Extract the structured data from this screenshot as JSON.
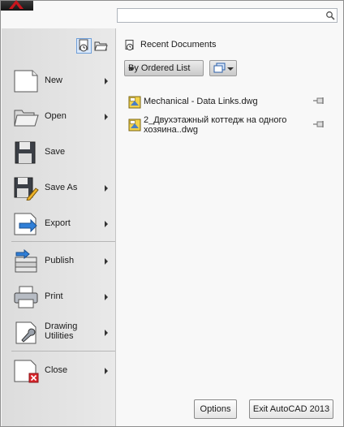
{
  "search": {
    "placeholder": ""
  },
  "menu": [
    {
      "label": "New",
      "icon": "new-document-icon",
      "submenu": true
    },
    {
      "label": "Open",
      "icon": "open-folder-icon",
      "submenu": true
    },
    {
      "label": "Save",
      "icon": "save-disk-icon",
      "submenu": false
    },
    {
      "label": "Save As",
      "icon": "save-as-icon",
      "submenu": true
    },
    {
      "label": "Export",
      "icon": "export-icon",
      "submenu": true
    },
    {
      "label": "Publish",
      "icon": "publish-icon",
      "submenu": true
    },
    {
      "label": "Print",
      "icon": "printer-icon",
      "submenu": true
    },
    {
      "label": "Drawing Utilities",
      "icon": "wrench-icon",
      "submenu": true
    },
    {
      "label": "Close",
      "icon": "close-document-icon",
      "submenu": true
    }
  ],
  "recent": {
    "title": "Recent Documents",
    "sort_label": "By Ordered List",
    "documents": [
      {
        "name": "Mechanical - Data Links.dwg"
      },
      {
        "name": "2_Двухэтажный коттедж на одного хозяина..dwg"
      }
    ]
  },
  "footer": {
    "options_label": "Options",
    "exit_label": "Exit AutoCAD 2013"
  },
  "colors": {
    "accent": "#c8161d",
    "selected_toggle": "#dbe9fb"
  }
}
